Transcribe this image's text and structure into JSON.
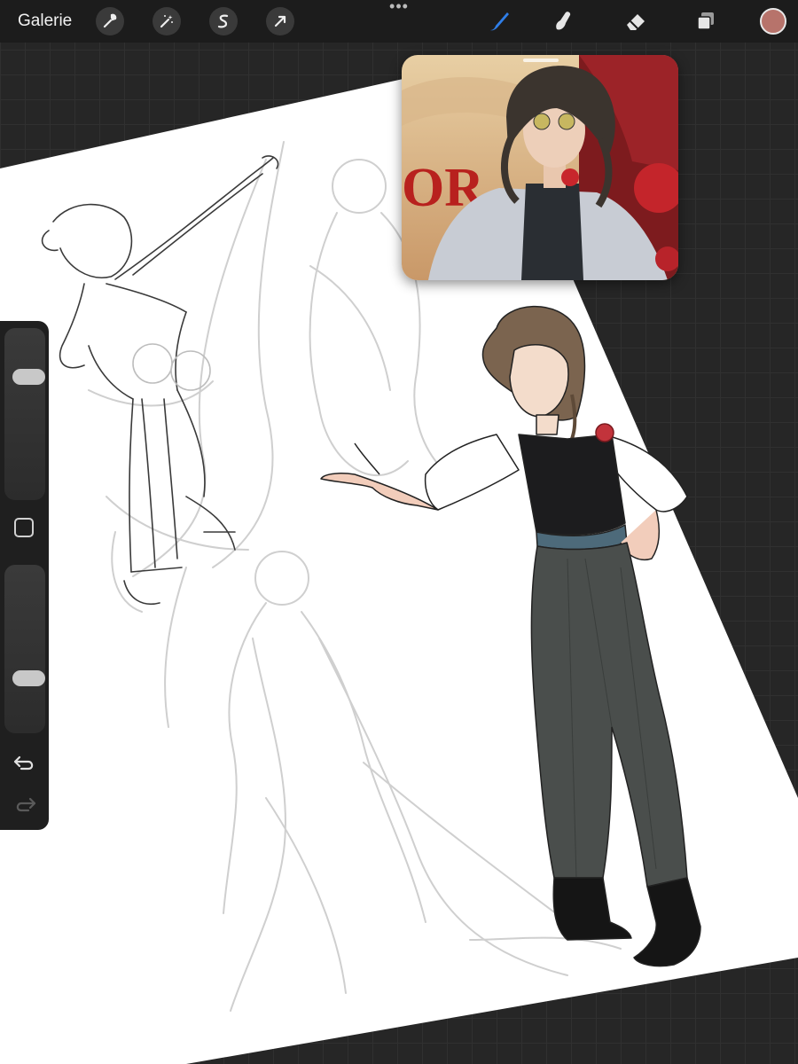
{
  "topbar": {
    "gallery_label": "Galerie",
    "actions_icon": "wrench-icon",
    "adjustments_icon": "magic-wand-icon",
    "selection_icon": "selection-s-icon",
    "transform_icon": "arrow-cursor-icon",
    "more_icon": "more-dots-icon",
    "brush_icon": "brush-icon",
    "smudge_icon": "smudge-icon",
    "eraser_icon": "eraser-icon",
    "layers_icon": "layers-icon",
    "current_color": "#b7736b",
    "active_tool_color": "#2f7ee8"
  },
  "sidebar": {
    "brush_size_level": 0.75,
    "brush_opacity_level": 0.3,
    "modify_icon": "square-icon",
    "undo_icon": "undo-icon",
    "redo_icon": "redo-icon"
  },
  "reference": {
    "image": "character-reference-artwork",
    "visible_text": "OR"
  },
  "canvas": {
    "content": "sketch-page-with-character-drawings",
    "paper_color": "#ffffff"
  }
}
